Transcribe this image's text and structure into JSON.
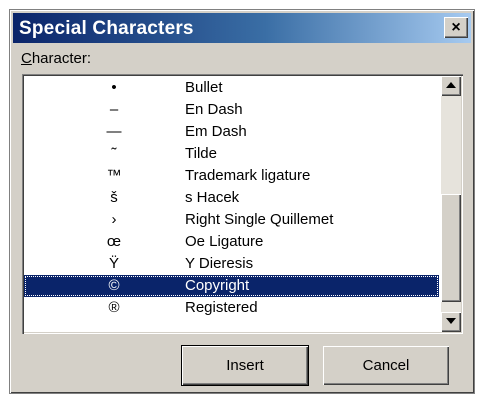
{
  "window": {
    "title": "Special Characters",
    "close_glyph": "×"
  },
  "field": {
    "label_mnemonic": "C",
    "label_rest": "haracter:"
  },
  "characters": [
    {
      "glyph": "•",
      "name": "Bullet"
    },
    {
      "glyph": "–",
      "name": "En Dash"
    },
    {
      "glyph": "—",
      "name": "Em Dash"
    },
    {
      "glyph": "˜",
      "name": "Tilde"
    },
    {
      "glyph": "™",
      "name": "Trademark ligature"
    },
    {
      "glyph": "š",
      "name": "s Hacek"
    },
    {
      "glyph": "›",
      "name": "Right Single Quillemet"
    },
    {
      "glyph": "œ",
      "name": "Oe Ligature"
    },
    {
      "glyph": "Ÿ",
      "name": "Y Dieresis"
    },
    {
      "glyph": "©",
      "name": "Copyright"
    },
    {
      "glyph": "®",
      "name": "Registered"
    }
  ],
  "selected_index": 9,
  "buttons": {
    "insert": "Insert",
    "cancel": "Cancel"
  },
  "icons": {
    "close": "close-icon",
    "scroll_up": "arrow-up-icon",
    "scroll_down": "arrow-down-icon"
  }
}
